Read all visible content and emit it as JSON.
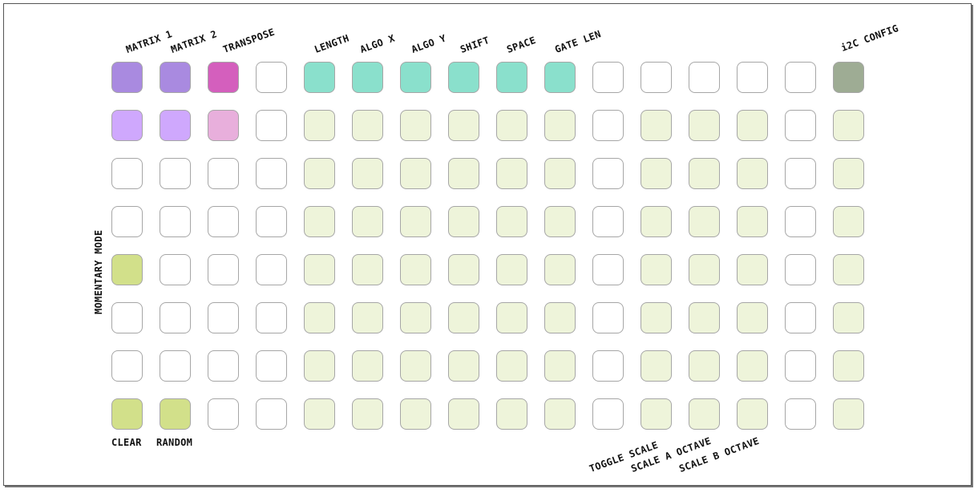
{
  "colors": {
    "white": "#ffffff",
    "matrix": "#a98ae0",
    "matrix_light": "#cfa8fd",
    "transpose": "#d45fbd",
    "transpose_light": "#e8afdc",
    "teal": "#8ae0cc",
    "pale": "#eef4da",
    "green": "#d2e08a",
    "config": "#9eac94"
  },
  "top_labels": [
    "MATRIX 1",
    "MATRIX 2",
    "TRANSPOSE",
    "LENGTH",
    "ALGO X",
    "ALGO Y",
    "SHIFT",
    "SPACE",
    "GATE LEN",
    "i2C CONFIG"
  ],
  "bottom_labels": [
    "CLEAR",
    "RANDOM"
  ],
  "bottom_rot_labels": [
    "TOGGLE SCALE",
    "SCALE A OCTAVE",
    "SCALE B OCTAVE"
  ],
  "side_label": "MOMENTARY MODE",
  "grid": [
    [
      "matrix",
      "matrix",
      "transpose",
      "white",
      "teal",
      "teal",
      "teal",
      "teal",
      "teal",
      "teal",
      "white",
      "white",
      "white",
      "white",
      "white",
      "config"
    ],
    [
      "matrix_light",
      "matrix_light",
      "transpose_light",
      "white",
      "pale",
      "pale",
      "pale",
      "pale",
      "pale",
      "pale",
      "white",
      "pale",
      "pale",
      "pale",
      "white",
      "pale"
    ],
    [
      "white",
      "white",
      "white",
      "white",
      "pale",
      "pale",
      "pale",
      "pale",
      "pale",
      "pale",
      "white",
      "pale",
      "pale",
      "pale",
      "white",
      "pale"
    ],
    [
      "white",
      "white",
      "white",
      "white",
      "pale",
      "pale",
      "pale",
      "pale",
      "pale",
      "pale",
      "white",
      "pale",
      "pale",
      "pale",
      "white",
      "pale"
    ],
    [
      "green",
      "white",
      "white",
      "white",
      "pale",
      "pale",
      "pale",
      "pale",
      "pale",
      "pale",
      "white",
      "pale",
      "pale",
      "pale",
      "white",
      "pale"
    ],
    [
      "white",
      "white",
      "white",
      "white",
      "pale",
      "pale",
      "pale",
      "pale",
      "pale",
      "pale",
      "white",
      "pale",
      "pale",
      "pale",
      "white",
      "pale"
    ],
    [
      "white",
      "white",
      "white",
      "white",
      "pale",
      "pale",
      "pale",
      "pale",
      "pale",
      "pale",
      "white",
      "pale",
      "pale",
      "pale",
      "white",
      "pale"
    ],
    [
      "green",
      "green",
      "white",
      "white",
      "pale",
      "pale",
      "pale",
      "pale",
      "pale",
      "pale",
      "white",
      "pale",
      "pale",
      "pale",
      "white",
      "pale"
    ]
  ]
}
